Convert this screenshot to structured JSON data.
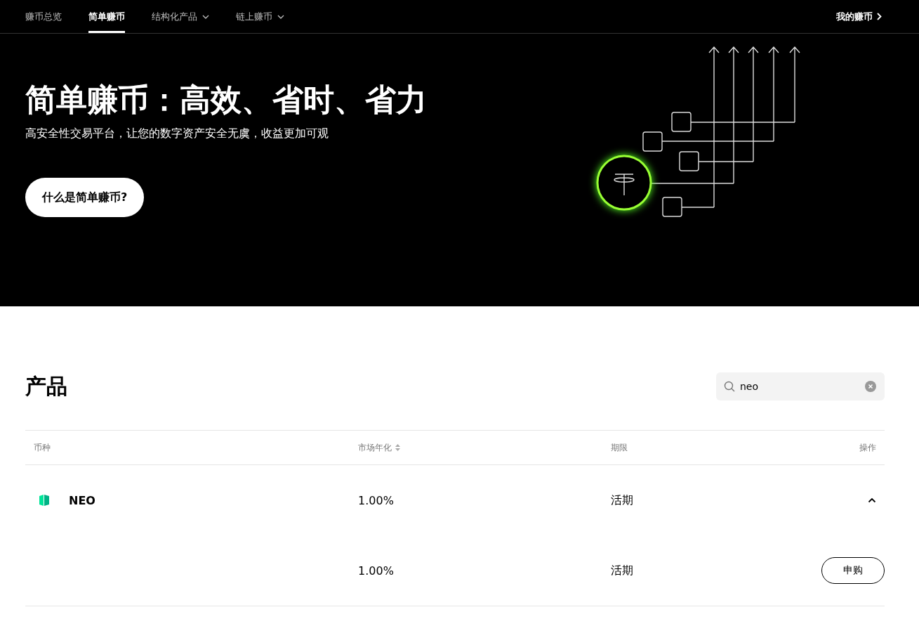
{
  "nav": {
    "tabs": [
      {
        "label": "赚币总览",
        "selected": false,
        "dropdown": false
      },
      {
        "label": "简单赚币",
        "selected": true,
        "dropdown": false
      },
      {
        "label": "结构化产品",
        "selected": false,
        "dropdown": true
      },
      {
        "label": "链上赚币",
        "selected": false,
        "dropdown": true
      }
    ],
    "account_link": "我的赚币"
  },
  "hero": {
    "title": "简单赚币：高效、省时、省力",
    "subtitle": "高安全性交易平台，让您的数字资产安全无虞，收益更加可观",
    "button": "什么是简单赚币?"
  },
  "products": {
    "title": "产品",
    "search": {
      "value": "neo"
    },
    "columns": [
      {
        "label": "币种",
        "sortable": false
      },
      {
        "label": "市场年化",
        "sortable": true
      },
      {
        "label": "期限",
        "sortable": false
      },
      {
        "label": "操作",
        "sortable": false
      }
    ],
    "rows": [
      {
        "coin": "NEO",
        "rate": "1.00%",
        "term": "活期",
        "expanded": true,
        "children": [
          {
            "rate": "1.00%",
            "term": "活期",
            "button": "申购"
          }
        ]
      }
    ]
  }
}
